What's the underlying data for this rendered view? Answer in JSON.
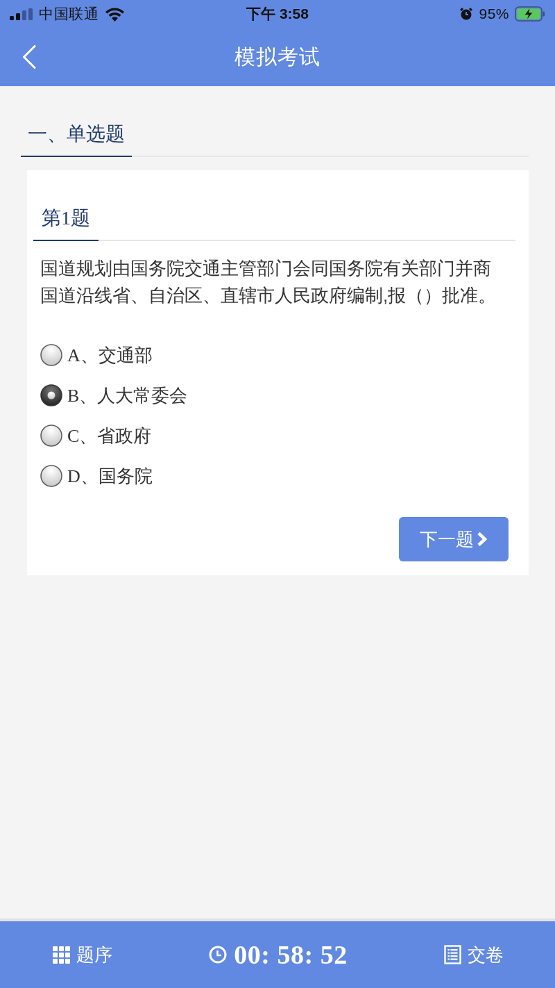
{
  "status_bar": {
    "carrier": "中国联通",
    "time": "下午 3:58",
    "battery": "95%"
  },
  "header": {
    "title": "模拟考试"
  },
  "section_tabs": [
    {
      "label": "一、单选题",
      "selected": true
    }
  ],
  "question": {
    "number": "第1题",
    "text": "国道规划由国务院交通主管部门会同国务院有关部门并商国道沿线省、自治区、直辖市人民政府编制,报（）批准。",
    "options": [
      {
        "label": "A、交通部",
        "selected": false
      },
      {
        "label": "B、人大常委会",
        "selected": true
      },
      {
        "label": "C、省政府",
        "selected": false
      },
      {
        "label": "D、国务院",
        "selected": false
      }
    ],
    "next_button": "下一题"
  },
  "footer": {
    "index_button": "题序",
    "timer": "00: 58: 52",
    "submit_button": "交卷"
  }
}
